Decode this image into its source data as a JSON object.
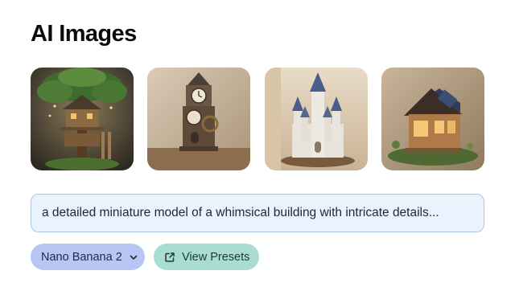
{
  "header": {
    "title": "AI Images"
  },
  "gallery": {
    "images": [
      {
        "icon": "treehouse-image"
      },
      {
        "icon": "clock-tower-image"
      },
      {
        "icon": "castle-image"
      },
      {
        "icon": "cabin-image"
      }
    ]
  },
  "prompt": {
    "value": "a detailed miniature model of a whimsical building with intricate details..."
  },
  "controls": {
    "model_label": "Nano Banana 2",
    "presets_label": "View Presets"
  },
  "colors": {
    "prompt_bg": "#eaf2fd",
    "prompt_border": "#a9c3ea",
    "model_button": "#b9c6f3",
    "presets_button": "#a9ddd0"
  }
}
